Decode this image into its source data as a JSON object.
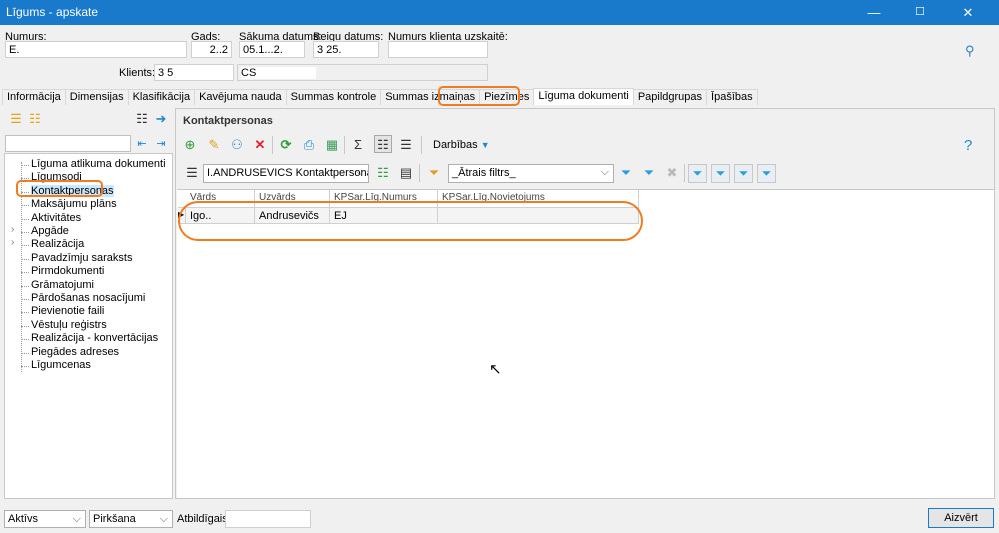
{
  "window": {
    "title": "Līgums - apskate",
    "minimize": "—",
    "maximize": "☐",
    "close": "✕"
  },
  "header": {
    "numurs": {
      "label": "Numurs:",
      "value": "E."
    },
    "gads": {
      "label": "Gads:",
      "value": "2..2"
    },
    "sakuma": {
      "label": "Sākuma datums:",
      "value": "05.1...2."
    },
    "beigu": {
      "label": "Beigu datums:",
      "value": "3          25."
    },
    "numurs_klienta": {
      "label": "Numurs klienta uzskaitē:",
      "value": ""
    },
    "klients": {
      "label": "Klients:",
      "code": "3        5",
      "name": "CS"
    }
  },
  "tabs": [
    "Informācija",
    "Dimensijas",
    "Klasifikācija",
    "Kavējuma nauda",
    "Summas kontrole",
    "Summas izmaiņas",
    "Piezīmes",
    "Līguma dokumenti",
    "Papildgrupas",
    "Īpašības"
  ],
  "active_tab": "Līguma dokumenti",
  "sidebar": {
    "search_placeholder": "",
    "items": [
      {
        "label": "Līguma atlikuma dokumenti"
      },
      {
        "label": "Līgumsodi"
      },
      {
        "label": "Kontaktpersonas",
        "selected": true
      },
      {
        "label": "Maksājumu plāns"
      },
      {
        "label": "Aktivitātes"
      },
      {
        "label": "Apgāde",
        "expandable": true
      },
      {
        "label": "Realizācija",
        "expandable": true
      },
      {
        "label": "Pavadzīmju saraksts"
      },
      {
        "label": "Pirmdokumenti"
      },
      {
        "label": "Grāmatojumi"
      },
      {
        "label": "Pārdošanas nosacījumi"
      },
      {
        "label": "Pievienotie faili"
      },
      {
        "label": "Vēstuļu reģistrs"
      },
      {
        "label": "Realizācija - konvertācijas"
      },
      {
        "label": "Piegādes adreses"
      },
      {
        "label": "Līgumcenas"
      }
    ]
  },
  "main": {
    "title": "Kontaktpersonas",
    "actions_label": "Darbības",
    "help": "?",
    "view_select": "I.ANDRUSEVICS Kontaktpersonas",
    "quick_filter": "_Ātrais filtrs_",
    "columns": [
      "Vārds",
      "Uzvārds",
      "KPSar.Līg.Numurs",
      "KPSar.Līg.Novietojums"
    ],
    "rows": [
      [
        "Igo..",
        "Andrusevičs",
        "EJ",
        ""
      ]
    ]
  },
  "footer": {
    "status": "Aktīvs",
    "type": "Pirkšana",
    "responsible_label": "Atbildīgais:",
    "responsible_value": "",
    "close": "Aizvērt"
  },
  "colors": {
    "titlebar": "#1979ca",
    "highlight": "#f07c22",
    "selection": "#cce8ff"
  }
}
